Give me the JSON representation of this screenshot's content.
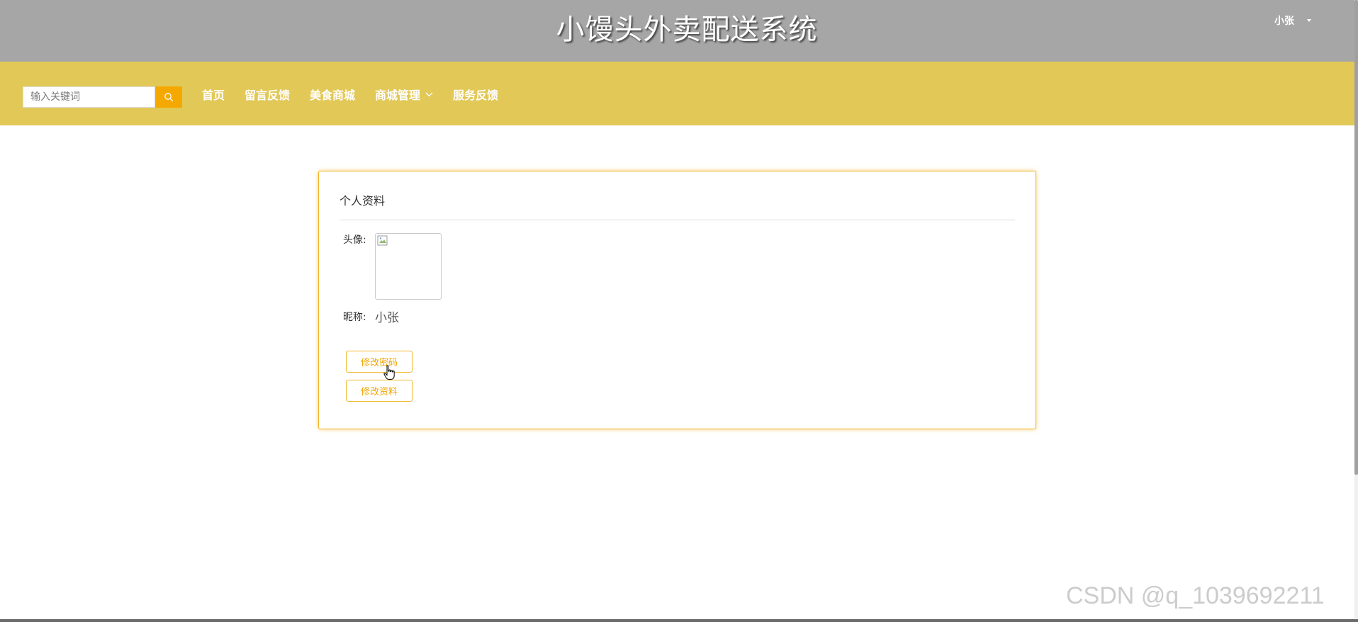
{
  "header": {
    "title": "小馒头外卖配送系统",
    "user_name": "小张",
    "user_caret_icon": "caret-down-icon"
  },
  "nav": {
    "search": {
      "placeholder": "输入关键词",
      "button_icon": "search-icon"
    },
    "items": [
      {
        "label": "首页"
      },
      {
        "label": "留言反馈"
      },
      {
        "label": "美食商城"
      },
      {
        "label": "商城管理",
        "has_dropdown": true
      },
      {
        "label": "服务反馈"
      }
    ]
  },
  "profile": {
    "title": "个人资料",
    "avatar_label": "头像:",
    "nickname_label": "昵称:",
    "nickname_value": "小张",
    "buttons": {
      "change_password": "修改密码",
      "edit_profile": "修改资料"
    }
  },
  "watermark": "CSDN @q_1039692211",
  "colors": {
    "banner_bg": "#a6a6a6",
    "nav_bg": "#e2c857",
    "accent": "#f5a800",
    "card_border": "#f0b429"
  }
}
